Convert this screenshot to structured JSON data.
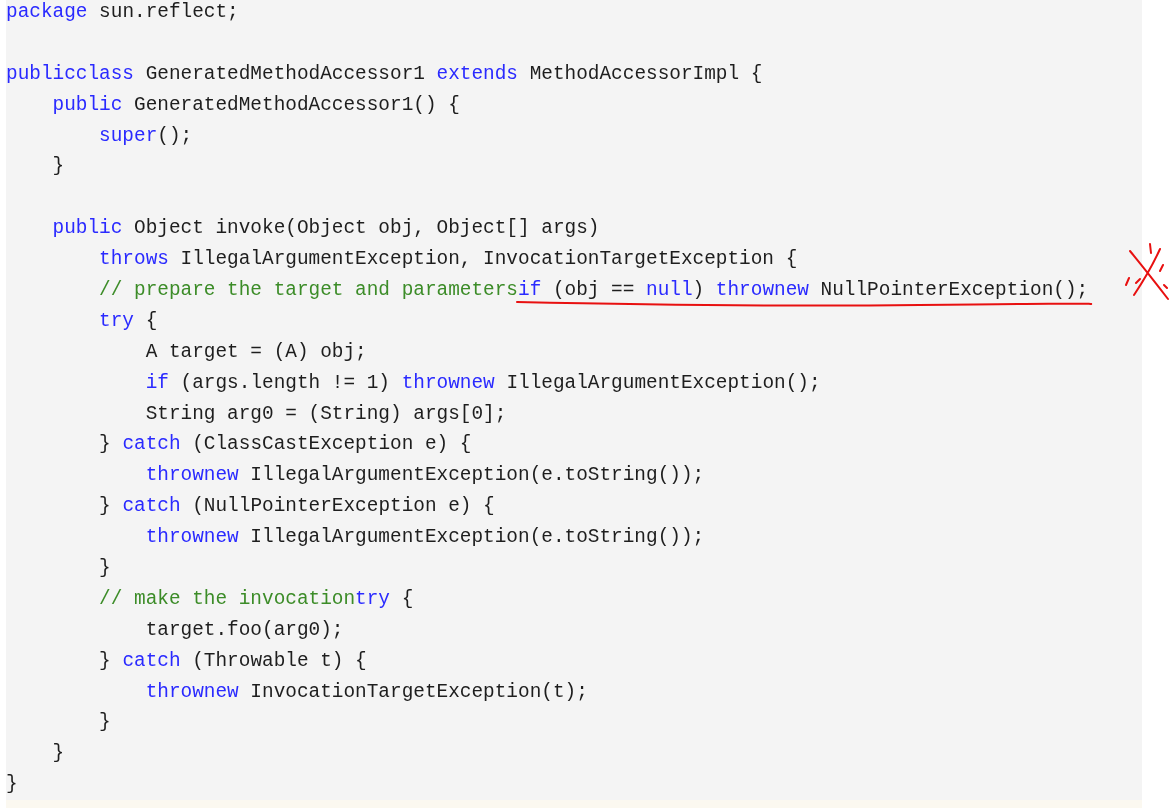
{
  "code_lines": [
    {
      "kind": "code",
      "tokens": [
        {
          "kind": "keyword",
          "text": "package"
        },
        {
          "kind": "plain",
          "text": " sun.reflect;"
        }
      ]
    },
    {
      "kind": "blank"
    },
    {
      "kind": "code",
      "tokens": [
        {
          "kind": "keyword",
          "text": "publicclass"
        },
        {
          "kind": "plain",
          "text": " GeneratedMethodAccessor1 "
        },
        {
          "kind": "keyword",
          "text": "extends"
        },
        {
          "kind": "plain",
          "text": " MethodAccessorImpl {"
        }
      ]
    },
    {
      "kind": "code",
      "tokens": [
        {
          "kind": "keyword",
          "text": "    public"
        },
        {
          "kind": "plain",
          "text": " GeneratedMethodAccessor1() {"
        }
      ]
    },
    {
      "kind": "code",
      "tokens": [
        {
          "kind": "keyword",
          "text": "        super"
        },
        {
          "kind": "plain",
          "text": "();"
        }
      ]
    },
    {
      "kind": "code",
      "tokens": [
        {
          "kind": "plain",
          "text": "    }"
        }
      ]
    },
    {
      "kind": "blank"
    },
    {
      "kind": "code",
      "tokens": [
        {
          "kind": "keyword",
          "text": "    public"
        },
        {
          "kind": "plain",
          "text": " Object invoke(Object obj, Object[] args)"
        }
      ]
    },
    {
      "kind": "code",
      "tokens": [
        {
          "kind": "keyword",
          "text": "        throws"
        },
        {
          "kind": "plain",
          "text": " IllegalArgumentException, InvocationTargetException {"
        }
      ]
    },
    {
      "kind": "code",
      "crossed": true,
      "tokens": [
        {
          "kind": "comment",
          "text": "        // prepare the target and parameters"
        },
        {
          "kind": "keyword",
          "text": "if",
          "underlined": true
        },
        {
          "kind": "plain",
          "text": " (obj == ",
          "underlined": true
        },
        {
          "kind": "keyword",
          "text": "null",
          "underlined": true
        },
        {
          "kind": "plain",
          "text": ") ",
          "underlined": true
        },
        {
          "kind": "keyword",
          "text": "thrownew",
          "underlined": true
        },
        {
          "kind": "plain",
          "text": " NullPointerException();",
          "underlined": true
        }
      ]
    },
    {
      "kind": "code",
      "tokens": [
        {
          "kind": "keyword",
          "text": "        try"
        },
        {
          "kind": "plain",
          "text": " {"
        }
      ]
    },
    {
      "kind": "code",
      "tokens": [
        {
          "kind": "plain",
          "text": "            A target = (A) obj;"
        }
      ]
    },
    {
      "kind": "code",
      "tokens": [
        {
          "kind": "keyword",
          "text": "            if"
        },
        {
          "kind": "plain",
          "text": " (args.length != 1) "
        },
        {
          "kind": "keyword",
          "text": "thrownew"
        },
        {
          "kind": "plain",
          "text": " IllegalArgumentException();"
        }
      ]
    },
    {
      "kind": "code",
      "tokens": [
        {
          "kind": "plain",
          "text": "            String arg0 = (String) args[0];"
        }
      ]
    },
    {
      "kind": "code",
      "tokens": [
        {
          "kind": "plain",
          "text": "        } "
        },
        {
          "kind": "keyword",
          "text": "catch"
        },
        {
          "kind": "plain",
          "text": " (ClassCastException e) {"
        }
      ]
    },
    {
      "kind": "code",
      "tokens": [
        {
          "kind": "keyword",
          "text": "            thrownew"
        },
        {
          "kind": "plain",
          "text": " IllegalArgumentException(e.toString());"
        }
      ]
    },
    {
      "kind": "code",
      "tokens": [
        {
          "kind": "plain",
          "text": "        } "
        },
        {
          "kind": "keyword",
          "text": "catch"
        },
        {
          "kind": "plain",
          "text": " (NullPointerException e) {"
        }
      ]
    },
    {
      "kind": "code",
      "tokens": [
        {
          "kind": "keyword",
          "text": "            thrownew"
        },
        {
          "kind": "plain",
          "text": " IllegalArgumentException(e.toString());"
        }
      ]
    },
    {
      "kind": "code",
      "tokens": [
        {
          "kind": "plain",
          "text": "        }"
        }
      ]
    },
    {
      "kind": "code",
      "tokens": [
        {
          "kind": "comment",
          "text": "        // make the invocation"
        },
        {
          "kind": "keyword",
          "text": "try"
        },
        {
          "kind": "plain",
          "text": " {"
        }
      ]
    },
    {
      "kind": "code",
      "tokens": [
        {
          "kind": "plain",
          "text": "            target.foo(arg0);"
        }
      ]
    },
    {
      "kind": "code",
      "tokens": [
        {
          "kind": "plain",
          "text": "        } "
        },
        {
          "kind": "keyword",
          "text": "catch"
        },
        {
          "kind": "plain",
          "text": " (Throwable t) {"
        }
      ]
    },
    {
      "kind": "code",
      "tokens": [
        {
          "kind": "keyword",
          "text": "            thrownew"
        },
        {
          "kind": "plain",
          "text": " InvocationTargetException(t);"
        }
      ]
    },
    {
      "kind": "code",
      "tokens": [
        {
          "kind": "plain",
          "text": "        }"
        }
      ]
    },
    {
      "kind": "code",
      "tokens": [
        {
          "kind": "plain",
          "text": "    }"
        }
      ]
    },
    {
      "kind": "code",
      "tokens": [
        {
          "kind": "plain",
          "text": "}"
        }
      ]
    }
  ]
}
